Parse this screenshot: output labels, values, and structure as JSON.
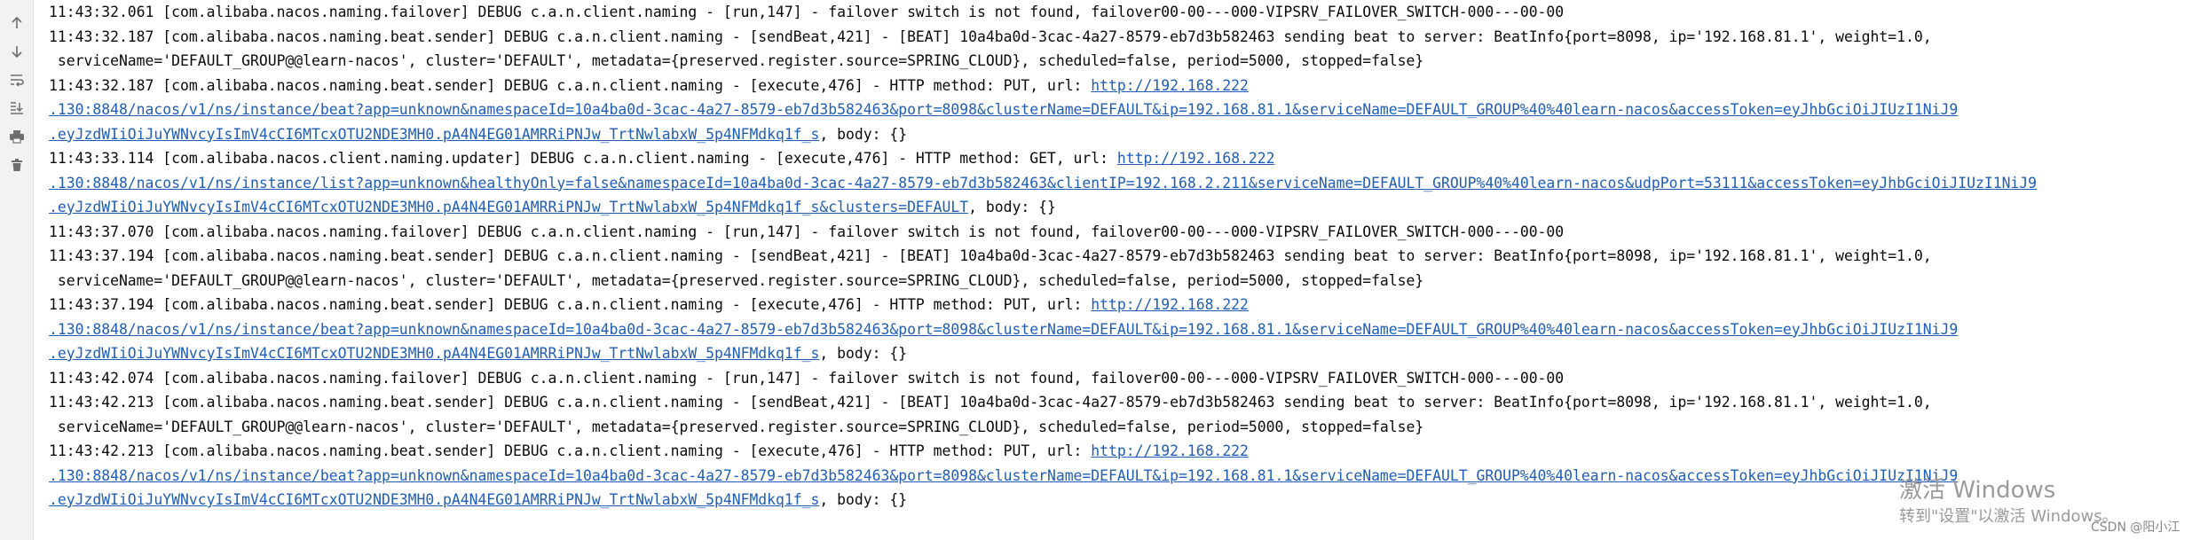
{
  "toolbar": {
    "icons": [
      "up-arrow-icon",
      "down-arrow-icon",
      "soft-wrap-icon",
      "scroll-to-end-icon",
      "print-icon",
      "trash-icon"
    ]
  },
  "console": {
    "lines": [
      {
        "text": "11:43:32.061 [com.alibaba.nacos.naming.failover] DEBUG c.a.n.client.naming - [run,147] - failover switch is not found, failover00-00---000-VIPSRV_FAILOVER_SWITCH-000---00-00"
      },
      {
        "text": "11:43:32.187 [com.alibaba.nacos.naming.beat.sender] DEBUG c.a.n.client.naming - [sendBeat,421] - [BEAT] 10a4ba0d-3cac-4a27-8579-eb7d3b582463 sending beat to server: BeatInfo{port=8098, ip='192.168.81.1', weight=1.0,"
      },
      {
        "text": " serviceName='DEFAULT_GROUP@@learn-nacos', cluster='DEFAULT', metadata={preserved.register.source=SPRING_CLOUD}, scheduled=false, period=5000, stopped=false}"
      },
      {
        "text": "11:43:32.187 [com.alibaba.nacos.naming.beat.sender] DEBUG c.a.n.client.naming - [execute,476] - HTTP method: PUT, url: ",
        "link": "http://192.168.222"
      },
      {
        "text": "",
        "link": ".130:8848/nacos/v1/ns/instance/beat?app=unknown&namespaceId=10a4ba0d-3cac-4a27-8579-eb7d3b582463&port=8098&clusterName=DEFAULT&ip=192.168.81.1&serviceName=DEFAULT_GROUP%40%40learn-nacos&accessToken=eyJhbGciOiJIUzI1NiJ9"
      },
      {
        "text": "",
        "link": ".eyJzdWIiOiJuYWNvcyIsImV4cCI6MTcxOTU2NDE3MH0.pA4N4EG01AMRRiPNJw_TrtNwlabxW_5p4NFMdkq1f_s",
        "suffix": ", body: {}"
      },
      {
        "text": "11:43:33.114 [com.alibaba.nacos.client.naming.updater] DEBUG c.a.n.client.naming - [execute,476] - HTTP method: GET, url: ",
        "link": "http://192.168.222"
      },
      {
        "text": "",
        "link": ".130:8848/nacos/v1/ns/instance/list?app=unknown&healthyOnly=false&namespaceId=10a4ba0d-3cac-4a27-8579-eb7d3b582463&clientIP=192.168.2.211&serviceName=DEFAULT_GROUP%40%40learn-nacos&udpPort=53111&accessToken=eyJhbGciOiJIUzI1NiJ9"
      },
      {
        "text": "",
        "link": ".eyJzdWIiOiJuYWNvcyIsImV4cCI6MTcxOTU2NDE3MH0.pA4N4EG01AMRRiPNJw_TrtNwlabxW_5p4NFMdkq1f_s&clusters=DEFAULT",
        "suffix": ", body: {}"
      },
      {
        "text": "11:43:37.070 [com.alibaba.nacos.naming.failover] DEBUG c.a.n.client.naming - [run,147] - failover switch is not found, failover00-00---000-VIPSRV_FAILOVER_SWITCH-000---00-00"
      },
      {
        "text": "11:43:37.194 [com.alibaba.nacos.naming.beat.sender] DEBUG c.a.n.client.naming - [sendBeat,421] - [BEAT] 10a4ba0d-3cac-4a27-8579-eb7d3b582463 sending beat to server: BeatInfo{port=8098, ip='192.168.81.1', weight=1.0,"
      },
      {
        "text": " serviceName='DEFAULT_GROUP@@learn-nacos', cluster='DEFAULT', metadata={preserved.register.source=SPRING_CLOUD}, scheduled=false, period=5000, stopped=false}"
      },
      {
        "text": "11:43:37.194 [com.alibaba.nacos.naming.beat.sender] DEBUG c.a.n.client.naming - [execute,476] - HTTP method: PUT, url: ",
        "link": "http://192.168.222"
      },
      {
        "text": "",
        "link": ".130:8848/nacos/v1/ns/instance/beat?app=unknown&namespaceId=10a4ba0d-3cac-4a27-8579-eb7d3b582463&port=8098&clusterName=DEFAULT&ip=192.168.81.1&serviceName=DEFAULT_GROUP%40%40learn-nacos&accessToken=eyJhbGciOiJIUzI1NiJ9"
      },
      {
        "text": "",
        "link": ".eyJzdWIiOiJuYWNvcyIsImV4cCI6MTcxOTU2NDE3MH0.pA4N4EG01AMRRiPNJw_TrtNwlabxW_5p4NFMdkq1f_s",
        "suffix": ", body: {}"
      },
      {
        "text": "11:43:42.074 [com.alibaba.nacos.naming.failover] DEBUG c.a.n.client.naming - [run,147] - failover switch is not found, failover00-00---000-VIPSRV_FAILOVER_SWITCH-000---00-00"
      },
      {
        "text": "11:43:42.213 [com.alibaba.nacos.naming.beat.sender] DEBUG c.a.n.client.naming - [sendBeat,421] - [BEAT] 10a4ba0d-3cac-4a27-8579-eb7d3b582463 sending beat to server: BeatInfo{port=8098, ip='192.168.81.1', weight=1.0,"
      },
      {
        "text": " serviceName='DEFAULT_GROUP@@learn-nacos', cluster='DEFAULT', metadata={preserved.register.source=SPRING_CLOUD}, scheduled=false, period=5000, stopped=false}"
      },
      {
        "text": "11:43:42.213 [com.alibaba.nacos.naming.beat.sender] DEBUG c.a.n.client.naming - [execute,476] - HTTP method: PUT, url: ",
        "link": "http://192.168.222"
      },
      {
        "text": "",
        "link": ".130:8848/nacos/v1/ns/instance/beat?app=unknown&namespaceId=10a4ba0d-3cac-4a27-8579-eb7d3b582463&port=8098&clusterName=DEFAULT&ip=192.168.81.1&serviceName=DEFAULT_GROUP%40%40learn-nacos&accessToken=eyJhbGciOiJIUzI1NiJ9"
      },
      {
        "text": "",
        "link": ".eyJzdWIiOiJuYWNvcyIsImV4cCI6MTcxOTU2NDE3MH0.pA4N4EG01AMRRiPNJw_TrtNwlabxW_5p4NFMdkq1f_s",
        "suffix": ", body: {}"
      }
    ]
  },
  "watermark": {
    "title": "激活 Windows",
    "subtitle": "转到\"设置\"以激活 Windows。"
  },
  "credit": "CSDN @阳小江",
  "colors": {
    "link": "#1f5eb8",
    "text": "#0a0a0a",
    "toolbar_bg": "#f2f2f2"
  }
}
